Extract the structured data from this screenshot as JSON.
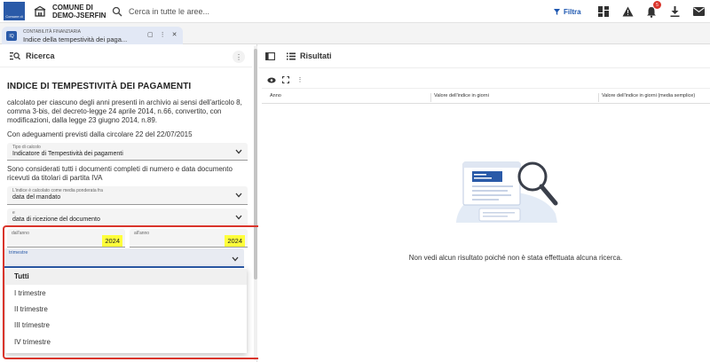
{
  "topbar": {
    "logo_text": "Comune di",
    "org_line1": "COMUNE DI",
    "org_line2": "DEMO-JSERFIN",
    "search_placeholder": "Cerca in tutte le aree...",
    "filter_label": "Filtra",
    "notification_count": "5",
    "icons": [
      "home-icon",
      "search-icon",
      "filter-icon",
      "dashboard-icon",
      "warning-icon",
      "bell-icon",
      "download-icon",
      "mail-icon"
    ]
  },
  "tab": {
    "kicker": "CONTABILITÀ FINANZIARIA",
    "title": "Indice della tempestività dei paga...",
    "icon_text": "IQ"
  },
  "left": {
    "header": "Ricerca",
    "form_title": "INDICE DI TEMPESTIVITÀ DEI PAGAMENTI",
    "desc1": "calcolato per ciascuno degli anni presenti in archivio ai sensi dell'articolo 8, comma 3-bis, del decreto-legge 24 aprile 2014, n.66, convertito, con modificazioni, dalla legge 23 giugno 2014, n.89.",
    "desc2": "Con adeguamenti previsti dalla circolare 22 del 22/07/2015",
    "tipo_label": "Tipo di calcolo",
    "tipo_value": "Indicatore di Tempestività dei pagamenti",
    "desc3": "Sono considerati tutti i documenti completi di numero e data documento ricevuti da titolari di partita IVA",
    "media_label": "L'indice è calcolato come media ponderata fra",
    "media_value": "data del mandato",
    "e_label": "e",
    "e_value": "data di ricezione del documento",
    "dall_anno_label": "dall'anno",
    "dall_anno_value": "2024",
    "all_anno_label": "all'anno",
    "all_anno_value": "2024",
    "trimestre_label": "trimestre",
    "trimestre_options": [
      "Tutti",
      "I trimestre",
      "II trimestre",
      "III trimestre",
      "IV trimestre"
    ]
  },
  "right": {
    "header": "Risultati",
    "columns": [
      "Anno",
      "Valore dell'indice in giorni",
      "Valore dell'indice in giorni (media semplice)"
    ],
    "empty_message": "Non vedi alcun risultato poiché non è stata effettuata alcuna ricerca."
  },
  "colors": {
    "accent": "#2a5aa8",
    "highlight": "#ffff3b",
    "annotation_frame": "#d9342b"
  }
}
